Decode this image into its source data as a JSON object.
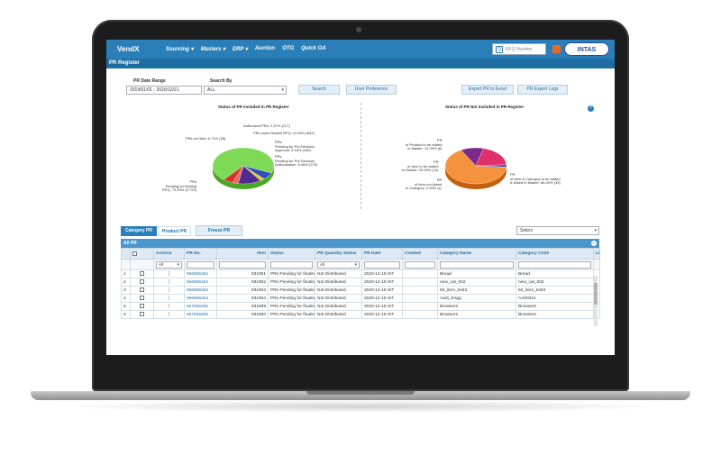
{
  "app": {
    "brand": "VendX",
    "logo": "INTAS",
    "rfq_placeholder": "RFQ Number"
  },
  "nav": {
    "items": [
      "Sourcing ▾",
      "Masters ▾",
      "ERP ▾",
      "Auction",
      "OTG",
      "Quick OA"
    ]
  },
  "page": {
    "title": "PR Register"
  },
  "filters": {
    "date_label": "PR Date Range",
    "date_value": "2019/01/01 - 2020/12/21",
    "search_by_label": "Search By",
    "search_by_value": "ALL"
  },
  "buttons": {
    "search": "Search",
    "user_pref": "User Preference",
    "export_excel": "Export PR to Excel",
    "export_logs": "PR Export Logs",
    "freeze": "Freeze PR"
  },
  "chart_data": [
    {
      "type": "pie",
      "title": "Status of PR included in PR Register",
      "slices": [
        {
          "label": "PRs Pending for floating RFQ",
          "percent": 73.2,
          "count": 3722,
          "color": "#7ed957"
        },
        {
          "label": "PRs on Hold",
          "percent": 6.71,
          "count": 38,
          "color": "#2f4fbf"
        },
        {
          "label": "Authorized PRs",
          "percent": 2.57,
          "count": 127,
          "color": "#e8c72b"
        },
        {
          "label": "PRs under floated RFQ",
          "percent": 12.6,
          "count": 633,
          "color": "#4f2a8f"
        },
        {
          "label": "PRs Pending for Pre Decision Approval",
          "percent": 3.16,
          "count": 156,
          "color": "#e06a6a"
        },
        {
          "label": "PRs Pending for Pre Decision Authorization",
          "percent": 5.46,
          "count": 270,
          "color": "#d9302c"
        }
      ],
      "annotations": {
        "green": "PRs\nPending for floating\nRFQ: 73.20% (3,722)",
        "hold": "PRs on Hold: 6.71% (38)",
        "auth": "Authorized PRs: 2.57% (127)",
        "floated": "PRs under floated RFQ: 12.60% (633)",
        "predec": "PRs\nPending for Pre Decision\nApproval: 3.16% (156)",
        "preauth": "PRs\nPending for Pre Decision\nAuthorization: 5.46% (270)"
      }
    },
    {
      "type": "pie",
      "title": "Status of PR Not included in PR Register",
      "slices": [
        {
          "label": "PR of Item & Category to be added & linked in Master",
          "percent": 66.0,
          "count": 33,
          "color": "#f5923e"
        },
        {
          "label": "PR of Product to be added in Master",
          "percent": 12.0,
          "count": 6,
          "color": "#7a2a8a"
        },
        {
          "label": "PR of Item to be added in Master",
          "percent": 20.0,
          "count": 10,
          "color": "#e0306c"
        },
        {
          "label": "PR of Item not linked to Category",
          "percent": 2.0,
          "count": 1,
          "color": "#2f4fbf"
        }
      ],
      "annotations": {
        "product": "PR\nof Product to be added\nin Master: 12.00% (6)",
        "item": "PR\nof Item to be added\nin Master: 20.00% (10)",
        "notlinked": "PR\nof Item not linked\nto Category: 2.00% (1)",
        "cat": "PR\nof Item & Category to be added\n& linked in Master: 66.00% (33)"
      }
    }
  ],
  "tabs": {
    "category": "Category PR",
    "product": "Product PR"
  },
  "select_placeholder": "Select",
  "grid": {
    "title": "All PR",
    "headers": [
      "",
      "",
      "Actions",
      "PR No.",
      "Item",
      "Status",
      "PR Quantity Status",
      "PR Date",
      "Created",
      "Category Name",
      "Category Code",
      "Lin"
    ],
    "filter_all": "All",
    "rows": [
      {
        "n": "1",
        "pr": "566555254",
        "item": "931901",
        "status": "PRs Pending for floatin",
        "qty": "Not Distributed",
        "date": "2020-12-18 IST",
        "cat": "Bread",
        "code": "Bread"
      },
      {
        "n": "2",
        "pr": "566555254",
        "item": "931902",
        "status": "PRs Pending for floatin",
        "qty": "Not Distributed",
        "date": "2020-12-18 IST",
        "cat": "new_cat_002",
        "code": "new_cat_002"
      },
      {
        "n": "3",
        "pr": "566555254",
        "item": "931903",
        "status": "PRs Pending for floatin",
        "qty": "Not Distributed",
        "date": "2020-12-18 IST",
        "cat": "50_item_test3",
        "code": "50_item_test3"
      },
      {
        "n": "4",
        "pr": "566555254",
        "item": "931904",
        "status": "PRs Pending for floatin",
        "qty": "Not Distributed",
        "date": "2020-12-18 IST",
        "cat": "Aarti_Engg",
        "code": "AA00321"
      },
      {
        "n": "5",
        "pr": "567555255",
        "item": "931899",
        "status": "PRs Pending for floatin",
        "qty": "Not Distributed",
        "date": "2020-12-18 IST",
        "cat": "Browsers",
        "code": "Browsers"
      },
      {
        "n": "6",
        "pr": "567555255",
        "item": "931900",
        "status": "PRs Pending for floatin",
        "qty": "Not Distributed",
        "date": "2020-12-18 IST",
        "cat": "Browsers",
        "code": "Browsers"
      }
    ]
  }
}
